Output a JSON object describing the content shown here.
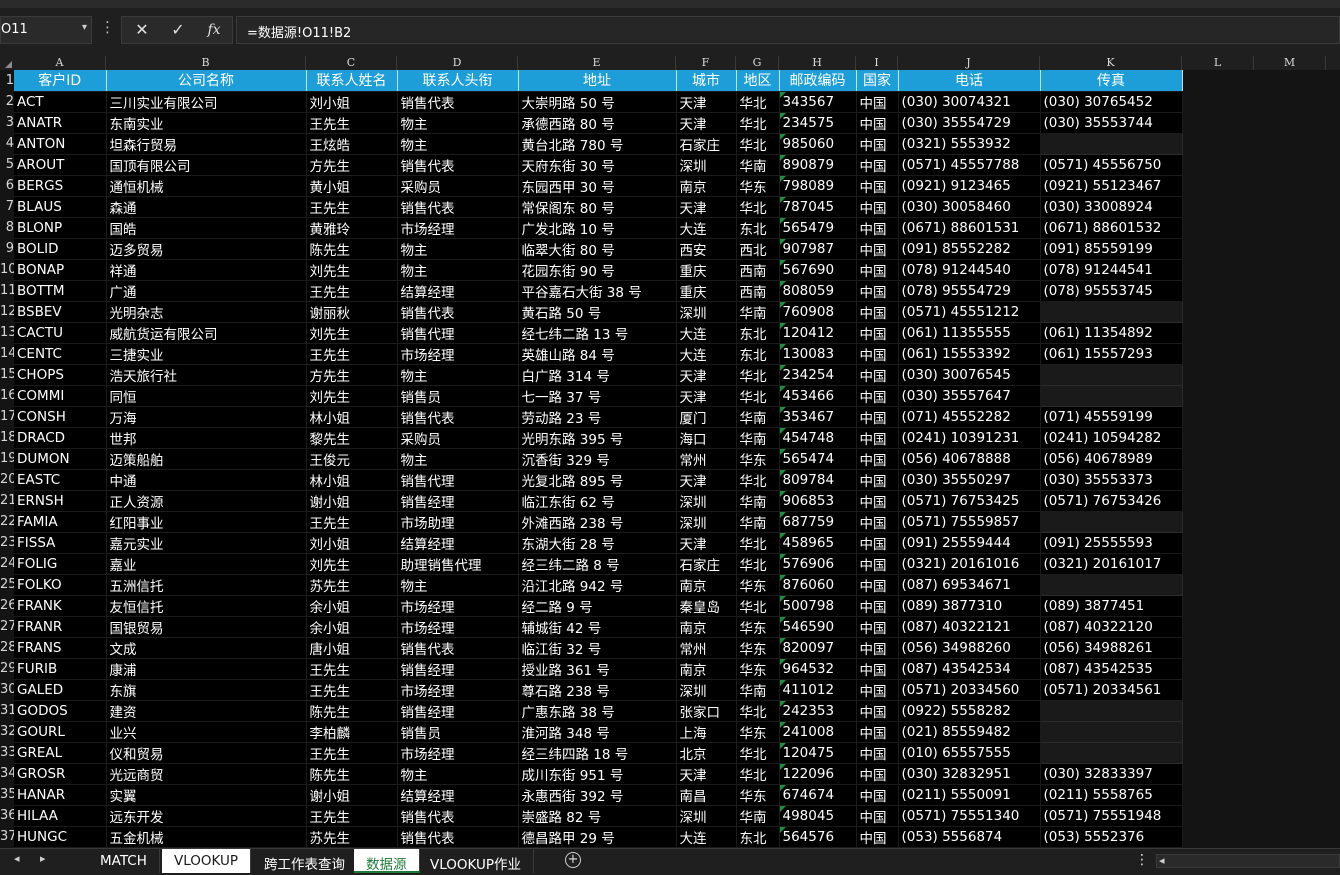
{
  "formula_bar": {
    "name_box": "O11",
    "more_icon": "vertical-ellipsis",
    "cancel_glyph": "✕",
    "enter_glyph": "✓",
    "fx_glyph": "fx",
    "formula": "=数据源!O11!B2"
  },
  "columns": [
    "A",
    "B",
    "C",
    "D",
    "E",
    "F",
    "G",
    "H",
    "I",
    "J",
    "K",
    "L",
    "M"
  ],
  "header_row": [
    "客户ID",
    "公司名称",
    "联系人姓名",
    "联系人头衔",
    "地址",
    "城市",
    "地区",
    "邮政编码",
    "国家",
    "电话",
    "传真"
  ],
  "row_numbers": [
    "1",
    "2",
    "3",
    "4",
    "5",
    "6",
    "7",
    "8",
    "9",
    "10",
    "11",
    "12",
    "13",
    "14",
    "15",
    "16",
    "17",
    "18",
    "19",
    "20",
    "21",
    "22",
    "23",
    "24",
    "25",
    "26",
    "27",
    "28",
    "29",
    "30",
    "31",
    "32",
    "33",
    "34",
    "35",
    "36",
    "37"
  ],
  "rows": [
    [
      "ACT",
      "三川实业有限公司",
      "刘小姐",
      "销售代表",
      "大崇明路 50 号",
      "天津",
      "华北",
      "343567",
      "中国",
      "(030) 30074321",
      "(030) 30765452"
    ],
    [
      "ANATR",
      "东南实业",
      "王先生",
      "物主",
      "承德西路 80 号",
      "天津",
      "华北",
      "234575",
      "中国",
      "(030) 35554729",
      "(030) 35553744"
    ],
    [
      "ANTON",
      "坦森行贸易",
      "王炫皓",
      "物主",
      "黄台北路 780 号",
      "石家庄",
      "华北",
      "985060",
      "中国",
      "(0321) 5553932",
      ""
    ],
    [
      "AROUT",
      "国顶有限公司",
      "方先生",
      "销售代表",
      "天府东街 30 号",
      "深圳",
      "华南",
      "890879",
      "中国",
      "(0571) 45557788",
      "(0571) 45556750"
    ],
    [
      "BERGS",
      "通恒机械",
      "黄小姐",
      "采购员",
      "东园西甲 30 号",
      "南京",
      "华东",
      "798089",
      "中国",
      "(0921) 9123465",
      "(0921) 55123467"
    ],
    [
      "BLAUS",
      "森通",
      "王先生",
      "销售代表",
      "常保阁东 80 号",
      "天津",
      "华北",
      "787045",
      "中国",
      "(030) 30058460",
      "(030)  33008924"
    ],
    [
      "BLONP",
      "国皓",
      "黄雅玲",
      "市场经理",
      "广发北路 10 号",
      "大连",
      "东北",
      "565479",
      "中国",
      "(0671) 88601531",
      "(0671) 88601532"
    ],
    [
      "BOLID",
      "迈多贸易",
      "陈先生",
      "物主",
      "临翠大街 80 号",
      "西安",
      "西北",
      "907987",
      "中国",
      "(091) 85552282",
      "(091) 85559199"
    ],
    [
      "BONAP",
      "祥通",
      "刘先生",
      "物主",
      "花园东街 90 号",
      "重庆",
      "西南",
      "567690",
      "中国",
      "(078) 91244540",
      "(078) 91244541"
    ],
    [
      "BOTTM",
      "广通",
      "王先生",
      "结算经理",
      "平谷嘉石大街 38 号",
      "重庆",
      "西南",
      "808059",
      "中国",
      "(078) 95554729",
      "(078) 95553745"
    ],
    [
      "BSBEV",
      "光明杂志",
      "谢丽秋",
      "销售代表",
      "黄石路 50 号",
      "深圳",
      "华南",
      "760908",
      "中国",
      "(0571) 45551212",
      ""
    ],
    [
      "CACTU",
      "威航货运有限公司",
      "刘先生",
      "销售代理",
      "经七纬二路 13 号",
      "大连",
      "东北",
      "120412",
      "中国",
      "(061) 11355555",
      "(061) 11354892"
    ],
    [
      "CENTC",
      "三捷实业",
      "王先生",
      "市场经理",
      "英雄山路 84 号",
      "大连",
      "东北",
      "130083",
      "中国",
      "(061) 15553392",
      "(061) 15557293"
    ],
    [
      "CHOPS",
      "浩天旅行社",
      "方先生",
      "物主",
      "白广路 314 号",
      "天津",
      "华北",
      "234254",
      "中国",
      "(030) 30076545",
      ""
    ],
    [
      "COMMI",
      "同恒",
      "刘先生",
      "销售员",
      "七一路 37 号",
      "天津",
      "华北",
      "453466",
      "中国",
      "(030) 35557647",
      ""
    ],
    [
      "CONSH",
      "万海",
      "林小姐",
      "销售代表",
      "劳动路 23 号",
      "厦门",
      "华南",
      "353467",
      "中国",
      "(071) 45552282",
      "(071) 45559199"
    ],
    [
      "DRACD",
      "世邦",
      "黎先生",
      "采购员",
      "光明东路 395 号",
      "海口",
      "华南",
      "454748",
      "中国",
      "(0241) 10391231",
      "(0241) 10594282"
    ],
    [
      "DUMON",
      "迈策船舶",
      "王俊元",
      "物主",
      "沉香街 329 号",
      "常州",
      "华东",
      "565474",
      "中国",
      "(056) 40678888",
      "(056) 40678989"
    ],
    [
      "EASTC",
      "中通",
      "林小姐",
      "销售代理",
      "光复北路 895 号",
      "天津",
      "华北",
      "809784",
      "中国",
      "(030) 35550297",
      "(030) 35553373"
    ],
    [
      "ERNSH",
      "正人资源",
      "谢小姐",
      "销售经理",
      "临江东街 62 号",
      "深圳",
      "华南",
      "906853",
      "中国",
      "(0571) 76753425",
      "(0571) 76753426"
    ],
    [
      "FAMIA",
      "红阳事业",
      "王先生",
      "市场助理",
      "外滩西路 238 号",
      "深圳",
      "华南",
      "687759",
      "中国",
      "(0571) 75559857",
      ""
    ],
    [
      "FISSA",
      "嘉元实业",
      "刘小姐",
      "结算经理",
      "东湖大街 28 号",
      "天津",
      "华北",
      "458965",
      "中国",
      "(091) 25559444",
      "(091) 25555593"
    ],
    [
      "FOLIG",
      "嘉业",
      "刘先生",
      "助理销售代理",
      "经三纬二路 8 号",
      "石家庄",
      "华北",
      "576906",
      "中国",
      "(0321) 20161016",
      "(0321) 20161017"
    ],
    [
      "FOLKO",
      "五洲信托",
      "苏先生",
      "物主",
      "沿江北路 942 号",
      "南京",
      "华东",
      "876060",
      "中国",
      "(087) 69534671",
      ""
    ],
    [
      "FRANK",
      "友恒信托",
      "余小姐",
      "市场经理",
      "经二路 9 号",
      "秦皇岛",
      "华北",
      "500798",
      "中国",
      "(089) 3877310",
      "(089) 3877451"
    ],
    [
      "FRANR",
      "国银贸易",
      "余小姐",
      "市场经理",
      "辅城街 42 号",
      "南京",
      "华东",
      "546590",
      "中国",
      "(087) 40322121",
      "(087) 40322120"
    ],
    [
      "FRANS",
      "文成",
      "唐小姐",
      "销售代表",
      "临江街 32 号",
      "常州",
      "华东",
      "820097",
      "中国",
      "(056) 34988260",
      "(056) 34988261"
    ],
    [
      "FURIB",
      "康浦",
      "王先生",
      "销售经理",
      "授业路 361 号",
      "南京",
      "华东",
      "964532",
      "中国",
      "(087) 43542534",
      "(087) 43542535"
    ],
    [
      "GALED",
      "东旗",
      "王先生",
      "市场经理",
      "尊石路 238 号",
      "深圳",
      "华南",
      "411012",
      "中国",
      "(0571) 20334560",
      "(0571) 20334561"
    ],
    [
      "GODOS",
      "建资",
      "陈先生",
      "销售经理",
      "广惠东路 38 号",
      "张家口",
      "华北",
      "242353",
      "中国",
      "(0922) 5558282",
      ""
    ],
    [
      "GOURL",
      "业兴",
      "李柏麟",
      "销售员",
      "淮河路 348 号",
      "上海",
      "华东",
      "241008",
      "中国",
      "(021) 85559482",
      ""
    ],
    [
      "GREAL",
      "仪和贸易",
      "王先生",
      "市场经理",
      "经三纬四路 18 号",
      "北京",
      "华北",
      "120475",
      "中国",
      "(010) 65557555",
      ""
    ],
    [
      "GROSR",
      "光远商贸",
      "陈先生",
      "物主",
      "成川东街 951 号",
      "天津",
      "华北",
      "122096",
      "中国",
      "(030) 32832951",
      "(030) 32833397"
    ],
    [
      "HANAR",
      "实翼",
      "谢小姐",
      "结算经理",
      "永惠西街 392 号",
      "南昌",
      "华东",
      "674674",
      "中国",
      "(0211) 5550091",
      "(0211) 5558765"
    ],
    [
      "HILAA",
      "远东开发",
      "王先生",
      "销售代表",
      "崇盛路 82 号",
      "深圳",
      "华南",
      "498045",
      "中国",
      "(0571) 75551340",
      "(0571) 75551948"
    ],
    [
      "HUNGC",
      "五金机械",
      "苏先生",
      "销售代表",
      "德昌路甲 29 号",
      "大连",
      "东北",
      "564576",
      "中国",
      "(053) 5556874",
      "(053) 5552376"
    ]
  ],
  "tabs": {
    "nav_prev": "◂",
    "nav_next": "▸",
    "items": [
      "MATCH",
      "VLOOKUP",
      "跨工作表查询",
      "数据源",
      "VLOOKUP作业"
    ],
    "active": "数据源",
    "add_icon": "plus-circle",
    "more_icon": "vertical-ellipsis"
  },
  "colors": {
    "header_fill": "#1e9ed8",
    "cell_fill": "#000000",
    "active_tab_text": "#1e7a38",
    "comment_marker": "#1e8f3a"
  }
}
